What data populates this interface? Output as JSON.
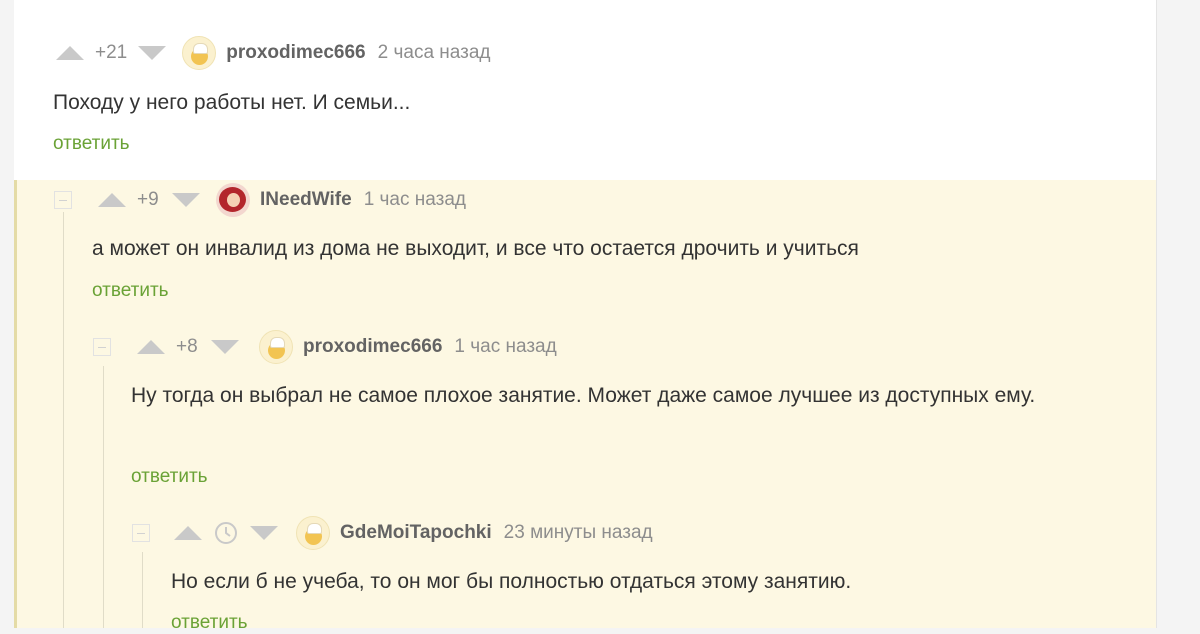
{
  "comments": [
    {
      "rating": "+21",
      "username": "proxodimec666",
      "time": "2 часа назад",
      "text": "Походу у него работы нет. И семьи...",
      "reply_label": "ответить"
    },
    {
      "rating": "+9",
      "username": "INeedWife",
      "time": "1 час назад",
      "text": "а может он инвалид из дома не выходит, и все что остается дрочить и учиться",
      "reply_label": "ответить"
    },
    {
      "rating": "+8",
      "username": "proxodimec666",
      "time": "1 час назад",
      "text": "Ну тогда он выбрал не самое плохое занятие. Может даже самое лучшее из доступных ему.",
      "reply_label": "ответить"
    },
    {
      "rating": "",
      "username": "GdeMoiTapochki",
      "time": "23 минуты назад",
      "text": "Но если б не учеба, то он мог бы полностью отдаться этому занятию.",
      "reply_label": "ответить"
    }
  ],
  "icons": {
    "vote_up": "triangle-up-icon",
    "vote_down": "triangle-down-icon",
    "rating_hidden": "clock-icon",
    "collapse": "minus-box-icon"
  },
  "colors": {
    "thread_background": "#fdf8e3",
    "reply_link": "#6aa236",
    "vote_arrow": "#c9c9c9",
    "muted_text": "#8d8d8d"
  }
}
